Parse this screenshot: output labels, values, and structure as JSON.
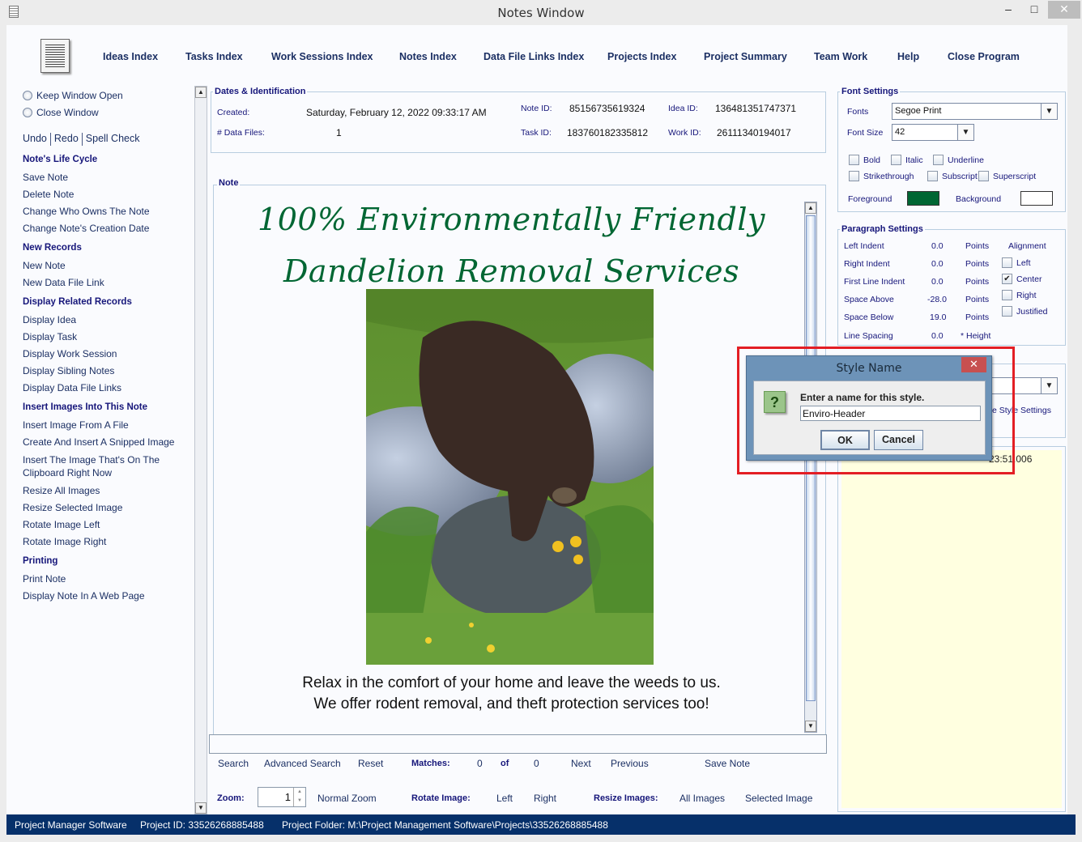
{
  "window": {
    "title": "Notes Window",
    "minimize_label": "–",
    "maximize_label": "□",
    "close_label": "✕"
  },
  "nav": {
    "items": [
      {
        "label": "Ideas Index",
        "mnemonic": "I"
      },
      {
        "label": "Tasks Index",
        "mnemonic": "T"
      },
      {
        "label": "Work Sessions Index",
        "mnemonic": "W"
      },
      {
        "label": "Notes Index",
        "mnemonic": "N"
      },
      {
        "label": "Data File Links Index",
        "mnemonic": "D"
      },
      {
        "label": "Projects Index",
        "mnemonic": ""
      },
      {
        "label": "Project Summary",
        "mnemonic": "P"
      },
      {
        "label": "Team Work",
        "mnemonic": "e"
      },
      {
        "label": "Help",
        "mnemonic": "H"
      },
      {
        "label": "Close Program",
        "mnemonic": "C"
      }
    ]
  },
  "sidebar": {
    "keep_window_open": "Keep Window Open",
    "close_window": "Close Window",
    "undo": "Undo",
    "redo": "Redo",
    "spell_check": "Spell Check",
    "sections": [
      {
        "heading": "Note's Life Cycle",
        "items": [
          "Save Note",
          "Delete Note",
          "Change Who Owns The Note",
          "Change Note's Creation Date"
        ]
      },
      {
        "heading": "New Records",
        "items": [
          "New Note",
          "New Data File Link"
        ]
      },
      {
        "heading": "Display Related Records",
        "items": [
          "Display Idea",
          "Display Task",
          "Display Work Session",
          "Display Sibling Notes",
          "Display Data File Links"
        ]
      },
      {
        "heading": "Insert Images Into This Note",
        "items": [
          "Insert Image From A File",
          "Create And Insert A Snipped Image",
          "Insert The Image That's On The Clipboard Right Now",
          "Resize All Images",
          "Resize Selected Image",
          "Rotate Image Left",
          "Rotate Image Right"
        ]
      },
      {
        "heading": "Printing",
        "items": [
          "Print Note",
          "Display Note In A Web Page"
        ]
      }
    ]
  },
  "dates": {
    "legend": "Dates & Identification",
    "created_label": "Created:",
    "created_value": "Saturday, February 12, 2022   09:33:17 AM",
    "data_files_label": "# Data Files:",
    "data_files_value": "1",
    "note_id_label": "Note ID:",
    "note_id_value": "85156735619324",
    "idea_id_label": "Idea ID:",
    "idea_id_value": "136481351747371",
    "task_id_label": "Task ID:",
    "task_id_value": "183760182335812",
    "work_id_label": "Work ID:",
    "work_id_value": "26111340194017"
  },
  "note": {
    "legend": "Note",
    "headline_line1": "100% Environmentally Friendly",
    "headline_line2": "Dandelion Removal Services",
    "headline_color": "#006633",
    "image_alt": "Bear on rocks among ferns and dandelions",
    "body_line1": "Relax in the comfort of your home and leave the weeds to us.",
    "body_line2": "We offer rodent removal, and theft protection services too!"
  },
  "search": {
    "input_value": "",
    "search": "Search",
    "advanced_search": "Advanced Search",
    "reset": "Reset",
    "matches_label": "Matches:",
    "matches_current": "0",
    "of_label": "of",
    "matches_total": "0",
    "next": "Next",
    "previous": "Previous",
    "save_note": "Save Note"
  },
  "image_tools": {
    "zoom_label": "Zoom:",
    "zoom_value": "1",
    "normal_zoom": "Normal Zoom",
    "rotate_label": "Rotate Image:",
    "rotate_left": "Left",
    "rotate_right": "Right",
    "resize_label": "Resize Images:",
    "resize_all": "All Images",
    "resize_selected": "Selected Image"
  },
  "font_settings": {
    "legend": "Font Settings",
    "fonts_label": "Fonts",
    "font_value": "Segoe Print",
    "size_label": "Font Size",
    "size_value": "42",
    "bold": "Bold",
    "italic": "Italic",
    "underline": "Underline",
    "strikethrough": "Strikethrough",
    "subscript": "Subscript",
    "superscript": "Superscript",
    "foreground_label": "Foreground",
    "foreground_color": "#006633",
    "background_label": "Background",
    "background_color": "#ffffff"
  },
  "paragraph_settings": {
    "legend": "Paragraph Settings",
    "rows": [
      {
        "label": "Left Indent",
        "value": "0.0",
        "unit": "Points"
      },
      {
        "label": "Right Indent",
        "value": "0.0",
        "unit": "Points"
      },
      {
        "label": "First Line Indent",
        "value": "0.0",
        "unit": "Points"
      },
      {
        "label": "Space Above",
        "value": "-28.0",
        "unit": "Points"
      },
      {
        "label": "Space Below",
        "value": "19.0",
        "unit": "Points"
      },
      {
        "label": "Line Spacing",
        "value": "0.0",
        "unit": "* Height"
      }
    ],
    "alignment_label": "Alignment",
    "alignments": [
      {
        "label": "Left",
        "checked": false
      },
      {
        "label": "Center",
        "checked": true
      },
      {
        "label": "Right",
        "checked": false
      },
      {
        "label": "Justified",
        "checked": false
      }
    ]
  },
  "style_panel": {
    "partial_link": "e Style Settings",
    "timestamp_partial": "23:51.006"
  },
  "dialog": {
    "title": "Style Name",
    "close_label": "✕",
    "icon": "?",
    "prompt": "Enter a name for this style.",
    "input_value": "Enviro-Header",
    "ok": "OK",
    "cancel": "Cancel",
    "highlight_color": "#e31e24"
  },
  "statusbar": {
    "app": "Project Manager Software",
    "project_id": "Project ID:  33526268885488",
    "project_folder": "Project Folder: M:\\Project Management Software\\Projects\\33526268885488"
  }
}
